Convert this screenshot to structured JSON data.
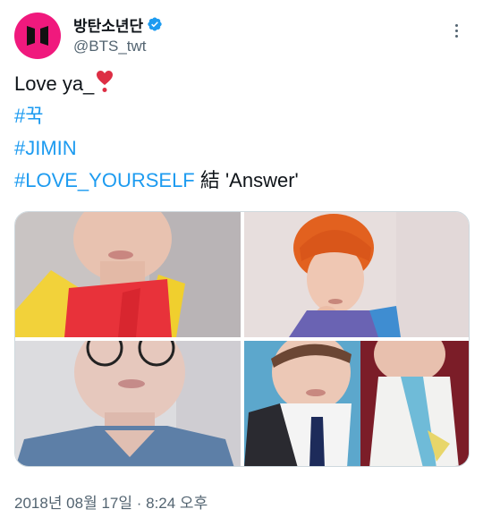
{
  "user": {
    "display_name": "방탄소년단",
    "handle": "@BTS_twt"
  },
  "tweet": {
    "line1": "Love ya_",
    "hashtag1": "#꾹",
    "hashtag2": "#JIMIN",
    "hashtag3": "#LOVE_YOURSELF",
    "line4_suffix": " 結 'Answer'"
  },
  "meta": {
    "date": "2018년 08월 17일",
    "separator": " · ",
    "time": "8:24 오후"
  },
  "icons": {
    "avatar": "bts-logo",
    "verified": "verified-badge-icon",
    "heart": "heart-exclamation-emoji",
    "more": "more-options-icon"
  },
  "colors": {
    "avatar_bg": "#f0197d",
    "link": "#1d9bf0",
    "secondary_text": "#536471",
    "primary_text": "#0f1419"
  }
}
